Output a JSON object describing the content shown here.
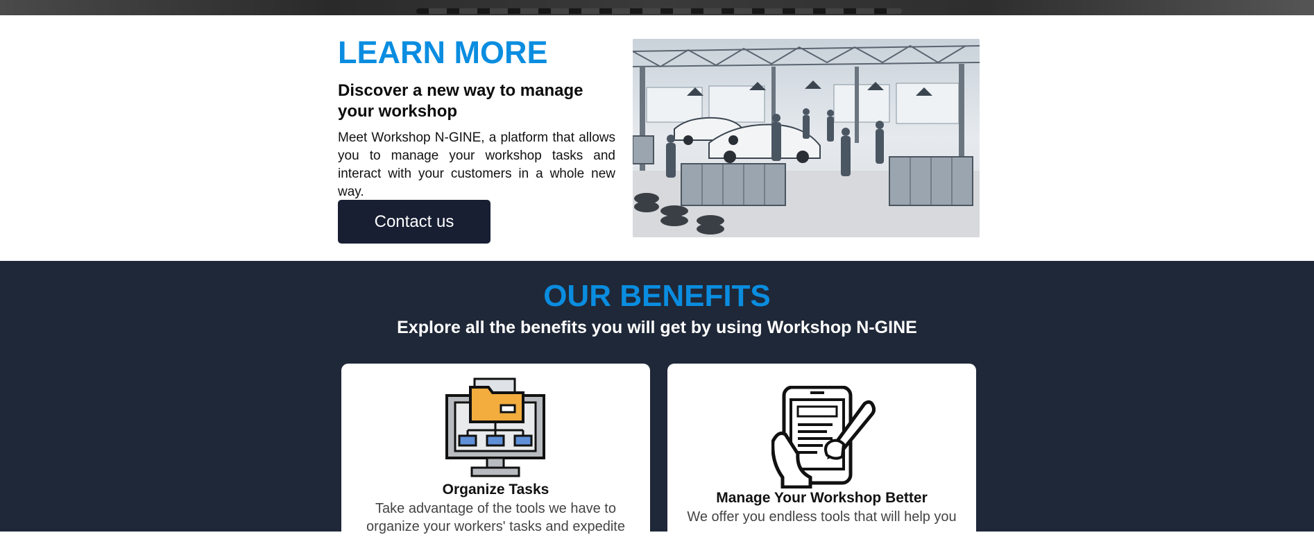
{
  "learn_more": {
    "title": "LEARN MORE",
    "subtitle": "Discover a new way to manage your workshop",
    "body": "Meet Workshop N-GINE, a platform that allows you to manage your workshop tasks and interact with your customers in a whole new way.",
    "button_label": "Contact us"
  },
  "benefits": {
    "title": "OUR BENEFITS",
    "subtitle": "Explore all the benefits you will get by using Workshop N-GINE",
    "cards": [
      {
        "icon": "computer-folder-hierarchy-icon",
        "title": "Organize Tasks",
        "description": "Take advantage of the tools we have to organize your workers' tasks and expedite"
      },
      {
        "icon": "tablet-hand-pen-icon",
        "title": "Manage Your Workshop Better",
        "description": "We offer you endless tools that will help you"
      }
    ]
  },
  "colors": {
    "accent": "#0a8de0",
    "dark_navy": "#1f2838",
    "button": "#181f33"
  }
}
